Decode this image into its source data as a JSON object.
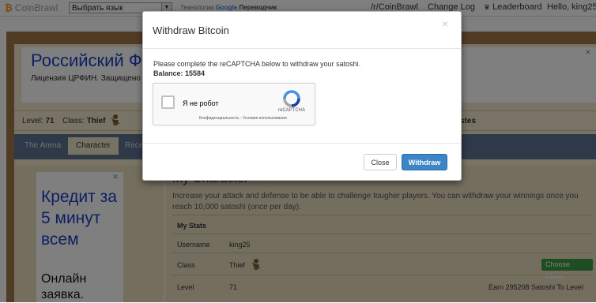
{
  "topbar": {
    "brand": "CoinBrawl",
    "language_select": "Выбрать язык",
    "powered_prefix": "Технологии",
    "powered_google": "Google",
    "powered_suffix": "Переводчик",
    "links": {
      "subreddit": "/r/CoinBrawl",
      "changelog": "Change Log",
      "leaderboard": "Leaderboard",
      "user": "Hello, king25!"
    }
  },
  "ad_top": {
    "headline": "Российский Ф",
    "subline": "Лицензия ЦРФИН. Защищено зак"
  },
  "stats": {
    "level_label": "Level:",
    "level_value": "71",
    "class_label": "Class:",
    "class_value": "Thief",
    "right_text": "stes"
  },
  "tabs": [
    "The Arena",
    "Character",
    "Recent"
  ],
  "ad_side": {
    "big_lines": "Кредит за 5 минут всем",
    "small_lines": "Онлайн заявка."
  },
  "main": {
    "title": "My Character",
    "description": "Increase your attack and defense to be able to challenge tougher players. You can withdraw your winnings once you reach 10,000 satoshi (once per day).",
    "table": {
      "heading": "My Stats",
      "rows": [
        {
          "label": "Username",
          "value": "king25"
        },
        {
          "label": "Class",
          "value": "Thief",
          "action": "Choose Class"
        },
        {
          "label": "Level",
          "value": "71",
          "note": "Earn 295208 Satoshi To Level"
        }
      ]
    }
  },
  "modal": {
    "title": "Withdraw Bitcoin",
    "close_x": "×",
    "message": "Please complete the reCAPTCHA below to withdraw your satoshi.",
    "balance_label": "Balance: 15584",
    "captcha": {
      "label": "Я не робот",
      "brand": "reCAPTCHA",
      "links": "Конфиденциальность - Условия использования"
    },
    "buttons": {
      "close": "Close",
      "withdraw": "Withdraw"
    }
  }
}
